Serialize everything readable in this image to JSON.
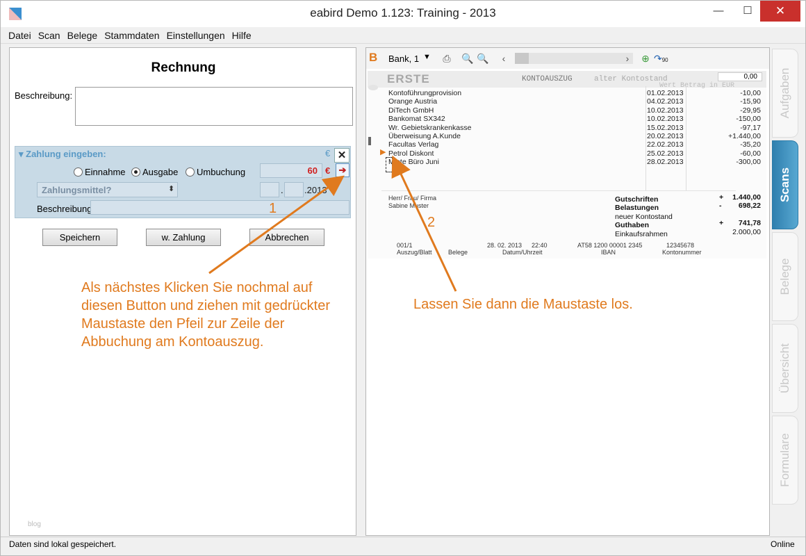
{
  "window": {
    "title": "eabird Demo 1.123: Training - 2013"
  },
  "menu": [
    "Datei",
    "Scan",
    "Belege",
    "Stammdaten",
    "Einstellungen",
    "Hilfe"
  ],
  "form": {
    "title": "Rechnung",
    "description_label": "Beschreibung:",
    "description_value": "",
    "payment": {
      "header": "Zahlung eingeben:",
      "currency_symbol": "€",
      "options": [
        "Einnahme",
        "Ausgabe",
        "Umbuchung"
      ],
      "selected": "Ausgabe",
      "amount": "60",
      "payment_method_placeholder": "Zahlungsmittel?",
      "year": "2013",
      "date_separator": ".",
      "description_label": "Beschreibung"
    },
    "buttons": {
      "save": "Speichern",
      "further_payment": "w. Zahlung",
      "cancel": "Abbrechen"
    },
    "watermark": "blog"
  },
  "annotations": {
    "left_text": "Als nächstes Klicken Sie nochmal auf diesen Button und ziehen mit gedrückter Maustaste den Pfeil zur Zeile der Abbuchung am Kontoauszug.",
    "right_text": "Lassen Sie dann die Maustaste los.",
    "marker1": "1",
    "marker2": "2",
    "color": "#e07a1e"
  },
  "scan_toolbar": {
    "logo": "B",
    "bank_select": "Bank, 1",
    "rotate_label": "90"
  },
  "statement": {
    "bank": "ERSTE",
    "title": "KONTOAUSZUG",
    "old_balance_label": "alter Kontostand",
    "old_balance": "0,00",
    "col_header": "Wert   Betrag in EUR",
    "rows": [
      {
        "desc": "Kontoführungprovision",
        "date": "01.02.2013",
        "amount": "-10,00"
      },
      {
        "desc": "Orange Austria",
        "date": "04.02.2013",
        "amount": "-15,90"
      },
      {
        "desc": "DiTech GmbH",
        "date": "10.02.2013",
        "amount": "-29,95"
      },
      {
        "desc": "Bankomat SX342",
        "date": "10.02.2013",
        "amount": "-150,00"
      },
      {
        "desc": "Wr. Gebietskrankenkasse",
        "date": "15.02.2013",
        "amount": "-97,17"
      },
      {
        "desc": "Überweisung A.Kunde",
        "date": "20.02.2013",
        "amount": "+1.440,00"
      },
      {
        "desc": "Facultas Verlag",
        "date": "22.02.2013",
        "amount": "-35,20"
      },
      {
        "desc": "Petrol Diskont",
        "date": "25.02.2013",
        "amount": "-60,00"
      },
      {
        "desc": "Miete Büro Juni",
        "date": "28.02.2013",
        "amount": "-300,00"
      }
    ],
    "addressee": [
      "Herr/ Frau/ Firma",
      "Sabine Muster"
    ],
    "totals": [
      {
        "label": "Gutschriften",
        "sign": "+",
        "value": "1.440,00",
        "bold": true
      },
      {
        "label": "Belastungen",
        "sign": "-",
        "value": "698,22",
        "bold": true
      },
      {
        "label": "neuer Kontostand",
        "sign": "",
        "value": "",
        "bold": false
      },
      {
        "label": "Guthaben",
        "sign": "+",
        "value": "741,78",
        "bold": true
      },
      {
        "label": "Einkaufsrahmen",
        "sign": "",
        "value": "2.000,00",
        "bold": false
      }
    ],
    "footer_values": [
      "001/1",
      "28. 02. 2013",
      "22:40",
      "AT58 1200 00001 2345",
      "12345678"
    ],
    "footer_labels": [
      "Auszug/Blatt",
      "Belege",
      "Datum/Uhrzeit",
      "IBAN",
      "Kontonummer"
    ]
  },
  "side_tabs": [
    {
      "label": "Aufgaben",
      "active": false
    },
    {
      "label": "Scans",
      "active": true
    },
    {
      "label": "Belege",
      "active": false
    },
    {
      "label": "Übersicht",
      "active": false
    },
    {
      "label": "Formulare",
      "active": false
    }
  ],
  "status": {
    "left": "Daten sind lokal gespeichert.",
    "right": "Online"
  }
}
